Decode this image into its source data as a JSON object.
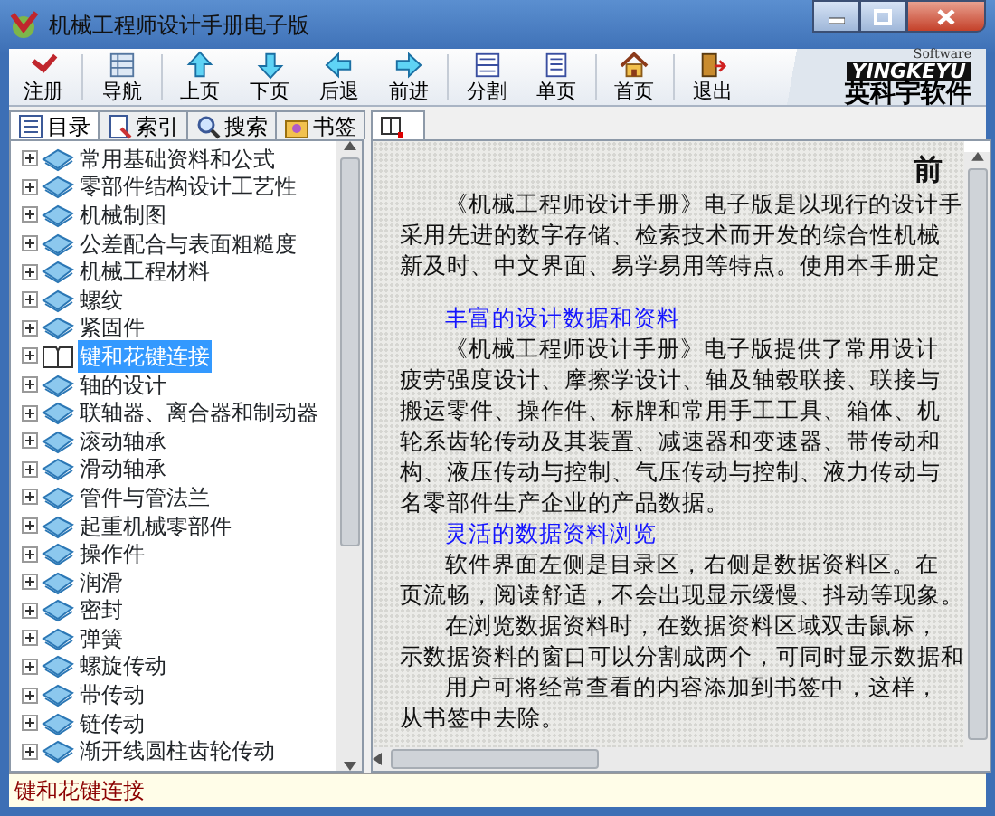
{
  "window": {
    "title": "机械工程师设计手册电子版"
  },
  "toolbar": [
    {
      "label": "注册",
      "group_start": false
    },
    {
      "label": "导航",
      "group_start": true
    },
    {
      "label": "上页",
      "group_start": true
    },
    {
      "label": "下页",
      "group_start": false
    },
    {
      "label": "后退",
      "group_start": false
    },
    {
      "label": "前进",
      "group_start": false
    },
    {
      "label": "分割",
      "group_start": true
    },
    {
      "label": "单页",
      "group_start": false
    },
    {
      "label": "首页",
      "group_start": true
    },
    {
      "label": "退出",
      "group_start": true
    }
  ],
  "logo": {
    "tagline": "Software",
    "brand": "YINGKEYU",
    "name": "英科宇软件"
  },
  "left_tabs": [
    {
      "label": "目录",
      "selected": true
    },
    {
      "label": "索引",
      "selected": false
    },
    {
      "label": "搜索",
      "selected": false
    },
    {
      "label": "书签",
      "selected": false
    }
  ],
  "tree": [
    {
      "label": "常用基础资料和公式",
      "expanded": false,
      "selected": false
    },
    {
      "label": "零部件结构设计工艺性",
      "expanded": false,
      "selected": false
    },
    {
      "label": "机械制图",
      "expanded": false,
      "selected": false
    },
    {
      "label": "公差配合与表面粗糙度",
      "expanded": false,
      "selected": false
    },
    {
      "label": "机械工程材料",
      "expanded": false,
      "selected": false
    },
    {
      "label": "螺纹",
      "expanded": false,
      "selected": false
    },
    {
      "label": "紧固件",
      "expanded": false,
      "selected": false
    },
    {
      "label": "键和花键连接",
      "expanded": false,
      "selected": true
    },
    {
      "label": "轴的设计",
      "expanded": false,
      "selected": false
    },
    {
      "label": "联轴器、离合器和制动器",
      "expanded": false,
      "selected": false
    },
    {
      "label": "滚动轴承",
      "expanded": false,
      "selected": false
    },
    {
      "label": "滑动轴承",
      "expanded": false,
      "selected": false
    },
    {
      "label": "管件与管法兰",
      "expanded": false,
      "selected": false
    },
    {
      "label": "起重机械零部件",
      "expanded": false,
      "selected": false
    },
    {
      "label": "操作件",
      "expanded": false,
      "selected": false
    },
    {
      "label": "润滑",
      "expanded": false,
      "selected": false
    },
    {
      "label": "密封",
      "expanded": false,
      "selected": false
    },
    {
      "label": "弹簧",
      "expanded": false,
      "selected": false
    },
    {
      "label": "螺旋传动",
      "expanded": false,
      "selected": false
    },
    {
      "label": "带传动",
      "expanded": false,
      "selected": false
    },
    {
      "label": "链传动",
      "expanded": false,
      "selected": false
    },
    {
      "label": "渐开线圆柱齿轮传动",
      "expanded": false,
      "selected": false
    }
  ],
  "content": [
    {
      "kind": "title",
      "text": "前"
    },
    {
      "kind": "first",
      "text": "《机械工程师设计手册》电子版是以现行的设计手"
    },
    {
      "kind": "line",
      "text": "采用先进的数字存储、检索技术而开发的综合性机械"
    },
    {
      "kind": "line",
      "text": "新及时、中文界面、易学易用等特点。使用本手册定"
    },
    {
      "kind": "gap"
    },
    {
      "kind": "subheading",
      "text": "丰富的设计数据和资料"
    },
    {
      "kind": "first",
      "text": "《机械工程师设计手册》电子版提供了常用设计"
    },
    {
      "kind": "line",
      "text": "疲劳强度设计、摩擦学设计、轴及轴毂联接、联接与"
    },
    {
      "kind": "line",
      "text": "搬运零件、操作件、标牌和常用手工工具、箱体、机"
    },
    {
      "kind": "line",
      "text": "轮系齿轮传动及其装置、减速器和变速器、带传动和"
    },
    {
      "kind": "line",
      "text": "构、液压传动与控制、气压传动与控制、液力传动与"
    },
    {
      "kind": "line",
      "text": "名零部件生产企业的产品数据。"
    },
    {
      "kind": "subheading",
      "text": "灵活的数据资料浏览"
    },
    {
      "kind": "first",
      "text": "软件界面左侧是目录区，右侧是数据资料区。在"
    },
    {
      "kind": "line",
      "text": "页流畅，阅读舒适，不会出现显示缓慢、抖动等现象。"
    },
    {
      "kind": "first",
      "text": "在浏览数据资料时，在数据资料区域双击鼠标，"
    },
    {
      "kind": "line",
      "text": "示数据资料的窗口可以分割成两个，可同时显示数据和"
    },
    {
      "kind": "first",
      "text": "用户可将经常查看的内容添加到书签中，这样，"
    },
    {
      "kind": "line",
      "text": "从书签中去除。"
    }
  ],
  "status_bar": {
    "text": "键和花键连接"
  }
}
